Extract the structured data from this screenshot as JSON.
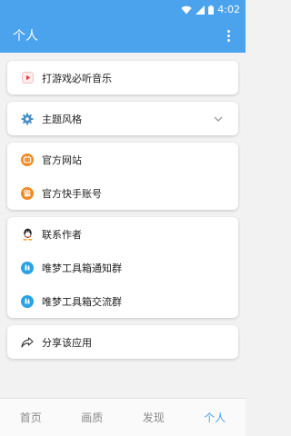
{
  "status_bar": {
    "time": "4:02",
    "icons": [
      "wifi-icon",
      "signal-icon",
      "battery-icon"
    ]
  },
  "app_bar": {
    "title": "个人",
    "menu_icon": "more-vert-icon"
  },
  "cards": [
    {
      "items": [
        {
          "label": "打游戏必听音乐",
          "icon": "play-icon"
        }
      ]
    },
    {
      "items": [
        {
          "label": "主题风格",
          "icon": "gear-icon",
          "trailing": "chevron-down-icon"
        }
      ]
    },
    {
      "items": [
        {
          "label": "官方网站",
          "icon": "bilibili-icon"
        },
        {
          "label": "官方快手账号",
          "icon": "kuaishou-icon"
        }
      ]
    },
    {
      "items": [
        {
          "label": "联系作者",
          "icon": "qq-icon"
        },
        {
          "label": "唯梦工具箱通知群",
          "icon": "qq-group-icon"
        },
        {
          "label": "唯梦工具箱交流群",
          "icon": "qq-group-icon"
        }
      ]
    },
    {
      "items": [
        {
          "label": "分享该应用",
          "icon": "share-icon"
        }
      ]
    }
  ],
  "bottom_nav": {
    "tabs": [
      "首页",
      "画质",
      "发现",
      "个人"
    ],
    "active_index": 3
  },
  "colors": {
    "primary": "#4aa3ec",
    "accent_orange": "#f08a24",
    "play_red": "#e53935",
    "background": "#f2f2f2"
  }
}
